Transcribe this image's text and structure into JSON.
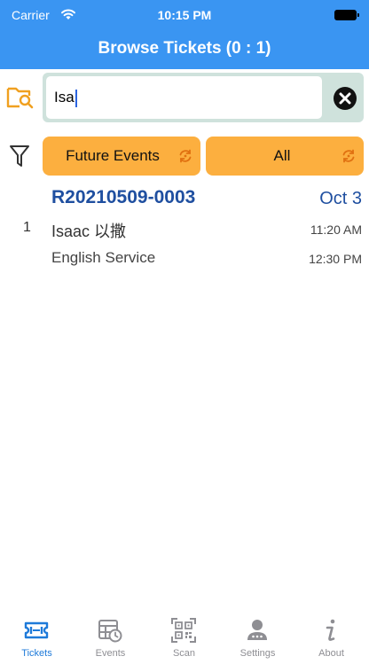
{
  "status_bar": {
    "carrier": "Carrier",
    "time": "10:15 PM"
  },
  "header": {
    "title": "Browse Tickets (0 : 1)"
  },
  "search": {
    "value": "Isa"
  },
  "filters": {
    "event_filter": "Future Events",
    "status_filter": "All"
  },
  "tickets": [
    {
      "index": "1",
      "id": "R20210509-0003",
      "date": "Oct 3",
      "name": "Isaac 以撒",
      "start_time": "11:20 AM",
      "service": "English Service",
      "end_time": "12:30 PM"
    }
  ],
  "tabbar": {
    "tabs": [
      {
        "label": "Tickets",
        "icon": "ticket-icon",
        "active": true
      },
      {
        "label": "Events",
        "icon": "events-calendar-icon",
        "active": false
      },
      {
        "label": "Scan",
        "icon": "qr-code-icon",
        "active": false
      },
      {
        "label": "Settings",
        "icon": "person-icon",
        "active": false
      },
      {
        "label": "About",
        "icon": "info-icon",
        "active": false
      }
    ]
  },
  "colors": {
    "header": "#3a95f2",
    "accent_orange": "#fcaf3f",
    "ticket_blue": "#1f4fa0",
    "tab_active": "#1e7ad9",
    "tab_inactive": "#8e8e93"
  }
}
